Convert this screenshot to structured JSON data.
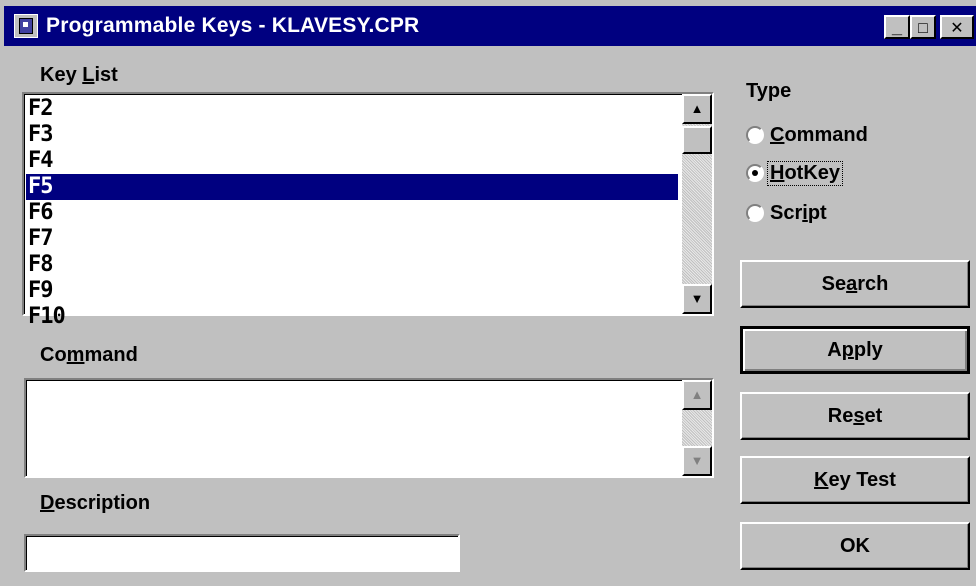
{
  "window": {
    "title": "Programmable Keys - KLAVESY.CPR",
    "minimize": "_",
    "maximize": "□",
    "close": "✕"
  },
  "key_list": {
    "label_pre": "Key ",
    "label_accel": "L",
    "label_post": "ist",
    "items": [
      "F2",
      "F3",
      "F4",
      "F5",
      "F6",
      "F7",
      "F8",
      "F9",
      "F10"
    ],
    "selected": "F5",
    "scroll_up": "▲",
    "scroll_down": "▼"
  },
  "type": {
    "label": "Type",
    "options": [
      {
        "pre": "",
        "accel": "C",
        "post": "ommand",
        "selected": false
      },
      {
        "pre": "",
        "accel": "H",
        "post": "otKey",
        "selected": true
      },
      {
        "pre": "Scr",
        "accel": "i",
        "post": "pt",
        "selected": false
      }
    ]
  },
  "command": {
    "label_pre": "Co",
    "label_accel": "m",
    "label_post": "mand",
    "value": "",
    "scroll_up": "▲",
    "scroll_down": "▼"
  },
  "description": {
    "label_pre": "",
    "label_accel": "D",
    "label_post": "escription",
    "value": ""
  },
  "buttons": {
    "search": {
      "pre": "Se",
      "accel": "a",
      "post": "rch"
    },
    "apply": {
      "pre": "A",
      "accel": "p",
      "post": "ply"
    },
    "reset": {
      "pre": "Re",
      "accel": "s",
      "post": "et"
    },
    "key_test": {
      "pre": "",
      "accel": "K",
      "post": "ey Test"
    },
    "ok": {
      "pre": "OK",
      "accel": "",
      "post": ""
    }
  }
}
